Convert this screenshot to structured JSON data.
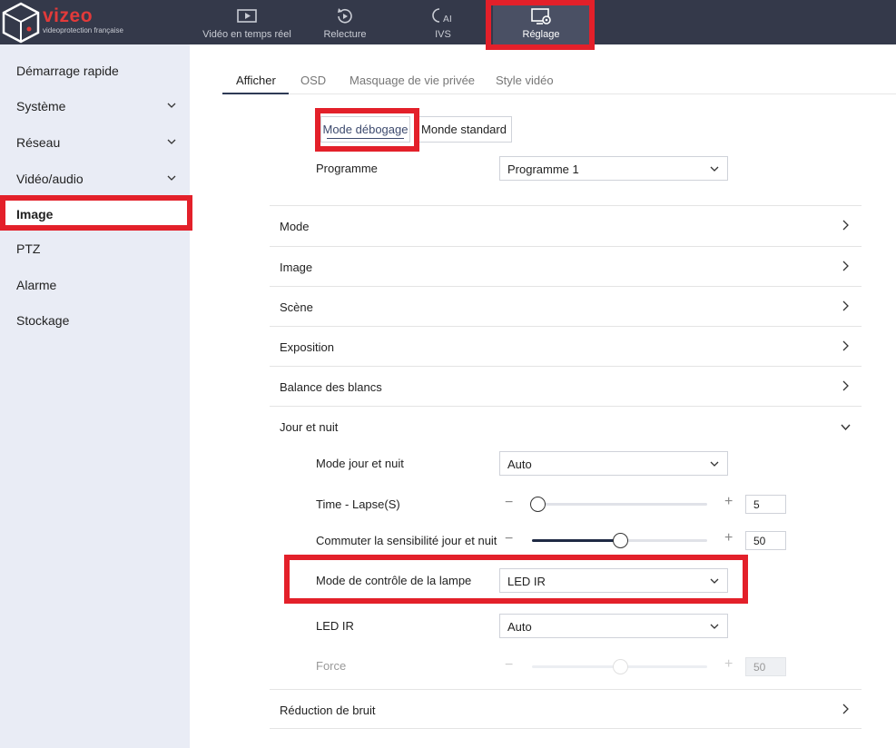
{
  "brand": {
    "name": "vizeo",
    "tagline": "videoprotection française",
    "accent": "#e23a3a",
    "highlight": "#e3202a"
  },
  "topnav": [
    {
      "label": "Vidéo en temps réel",
      "icon": "live-video-icon",
      "active": false
    },
    {
      "label": "Relecture",
      "icon": "replay-icon",
      "active": false
    },
    {
      "label": "IVS",
      "icon": "ivs-ai-icon",
      "active": false
    },
    {
      "label": "Réglage",
      "icon": "settings-monitor-icon",
      "active": true
    }
  ],
  "sidebar": {
    "items": [
      {
        "label": "Démarrage rapide",
        "expandable": false
      },
      {
        "label": "Système",
        "expandable": true
      },
      {
        "label": "Réseau",
        "expandable": true
      },
      {
        "label": "Vidéo/audio",
        "expandable": true
      },
      {
        "label": "Image",
        "expandable": false,
        "active": true
      },
      {
        "label": "PTZ",
        "expandable": false
      },
      {
        "label": "Alarme",
        "expandable": false
      },
      {
        "label": "Stockage",
        "expandable": false
      }
    ]
  },
  "tabs": [
    {
      "label": "Afficher",
      "active": true
    },
    {
      "label": "OSD"
    },
    {
      "label": "Masquage de vie privée"
    },
    {
      "label": "Style vidéo"
    }
  ],
  "mode_buttons": {
    "debug": "Mode débogage",
    "standard": "Monde standard"
  },
  "programme": {
    "label": "Programme",
    "value": "Programme 1"
  },
  "sections": {
    "mode": "Mode",
    "image": "Image",
    "scene": "Scène",
    "exposition": "Exposition",
    "balance": "Balance des blancs",
    "jour_nuit": "Jour et nuit",
    "reduction": "Réduction de bruit"
  },
  "jour_nuit": {
    "mode_label": "Mode jour et nuit",
    "mode_value": "Auto",
    "timelapse_label": "Time - Lapse(S)",
    "timelapse_value": "5",
    "timelapse_level": 0.03,
    "sensibilite_label": "Commuter la sensibilité jour et nuit",
    "sensibilite_value": "50",
    "sensibilite_level": 0.5,
    "lampe_label": "Mode de contrôle de la lampe",
    "lampe_value": "LED IR",
    "led_label": "LED IR",
    "led_value": "Auto",
    "force_label": "Force",
    "force_value": "50",
    "force_level": 0.5
  },
  "slider_signs": {
    "minus": "−",
    "plus": "+"
  }
}
